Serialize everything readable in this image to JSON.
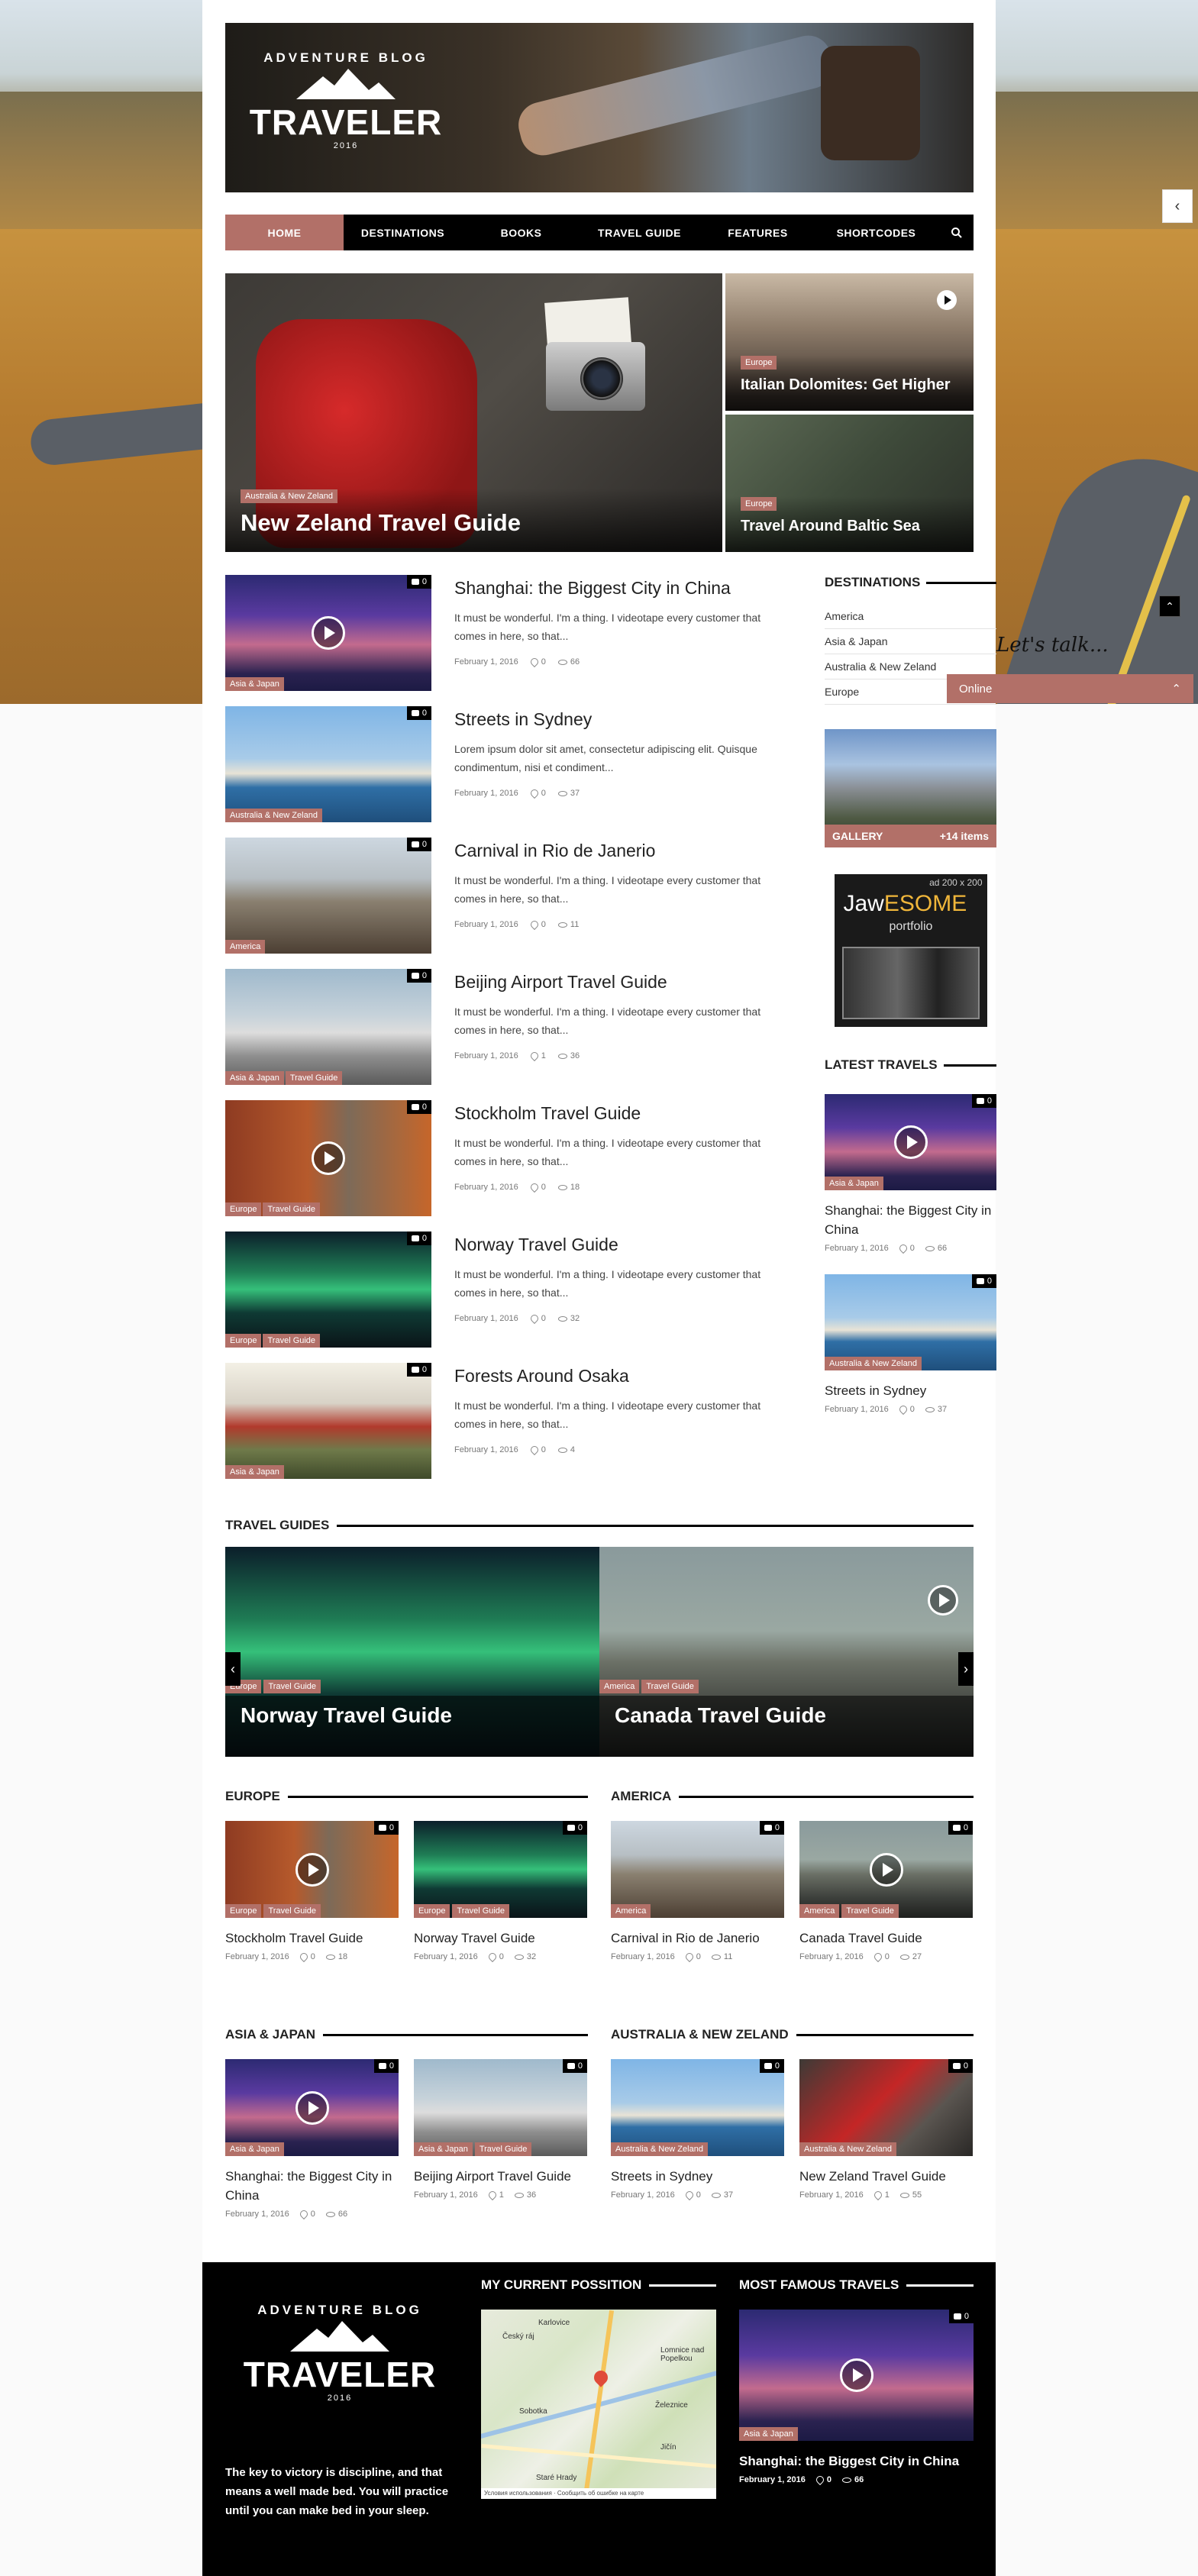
{
  "colors": {
    "accent": "#b27068",
    "nav_bg": "#000000",
    "footer_bg": "#000000"
  },
  "logo": {
    "arc": "ADVENTURE BLOG",
    "name": "TRAVELER",
    "year": "2016"
  },
  "nav": {
    "items": [
      {
        "label": "HOME",
        "active": true
      },
      {
        "label": "DESTINATIONS"
      },
      {
        "label": "BOOKS"
      },
      {
        "label": "TRAVEL GUIDE"
      },
      {
        "label": "FEATURES"
      },
      {
        "label": "SHORTCODES"
      }
    ],
    "search_icon": "search-icon"
  },
  "featured": {
    "main": {
      "tag": "Australia & New Zeland",
      "title": "New Zeland Travel Guide"
    },
    "side": [
      {
        "tag": "Europe",
        "title": "Italian Dolomites: Get Higher"
      },
      {
        "tag": "Europe",
        "title": "Travel Around Baltic Sea"
      }
    ]
  },
  "posts": [
    {
      "title": "Shanghai: the Biggest City in China",
      "excerpt": "It must be wonderful. I'm a thing. I videotape every customer that comes in here, so that...",
      "tags": [
        "Asia & Japan"
      ],
      "date": "February 1, 2016",
      "likes": "0",
      "views": "66",
      "comments": "0",
      "video": true
    },
    {
      "title": "Streets in Sydney",
      "excerpt": "Lorem ipsum dolor sit amet, consectetur adipiscing elit. Quisque condimentum, nisi et condiment...",
      "tags": [
        "Australia & New Zeland"
      ],
      "date": "February 1, 2016",
      "likes": "0",
      "views": "37",
      "comments": "0",
      "video": false
    },
    {
      "title": "Carnival in Rio de Janerio",
      "excerpt": "It must be wonderful. I'm a thing. I videotape every customer that comes in here, so that...",
      "tags": [
        "America"
      ],
      "date": "February 1, 2016",
      "likes": "0",
      "views": "11",
      "comments": "0",
      "video": false
    },
    {
      "title": "Beijing Airport Travel Guide",
      "excerpt": "It must be wonderful. I'm a thing. I videotape every customer that comes in here, so that...",
      "tags": [
        "Asia & Japan",
        "Travel Guide"
      ],
      "date": "February 1, 2016",
      "likes": "1",
      "views": "36",
      "comments": "0",
      "video": false
    },
    {
      "title": "Stockholm Travel Guide",
      "excerpt": "It must be wonderful. I'm a thing. I videotape every customer that comes in here, so that...",
      "tags": [
        "Europe",
        "Travel Guide"
      ],
      "date": "February 1, 2016",
      "likes": "0",
      "views": "18",
      "comments": "0",
      "video": true
    },
    {
      "title": "Norway Travel Guide",
      "excerpt": "It must be wonderful. I'm a thing. I videotape every customer that comes in here, so that...",
      "tags": [
        "Europe",
        "Travel Guide"
      ],
      "date": "February 1, 2016",
      "likes": "0",
      "views": "32",
      "comments": "0",
      "video": false
    },
    {
      "title": "Forests Around Osaka",
      "excerpt": "It must be wonderful. I'm a thing. I videotape every customer that comes in here, so that...",
      "tags": [
        "Asia & Japan"
      ],
      "date": "February 1, 2016",
      "likes": "0",
      "views": "4",
      "comments": "0",
      "video": false
    }
  ],
  "sidebar": {
    "destinations_title": "DESTINATIONS",
    "destinations": [
      "America",
      "Asia & Japan",
      "Australia & New Zeland",
      "Europe"
    ],
    "gallery_label": "GALLERY",
    "gallery_count": "+14 items",
    "ad": {
      "size": "ad 200 x 200",
      "title_a": "Jaw",
      "title_b": "ESOME",
      "sub": "portfolio"
    },
    "latest_title": "LATEST TRAVELS",
    "latest": [
      {
        "title": "Shanghai: the Biggest City in China",
        "tag": "Asia & Japan",
        "date": "February 1, 2016",
        "likes": "0",
        "views": "66",
        "comments": "0",
        "video": true
      },
      {
        "title": "Streets in Sydney",
        "tag": "Australia & New Zeland",
        "date": "February 1, 2016",
        "likes": "0",
        "views": "37",
        "comments": "0",
        "video": false
      }
    ]
  },
  "guides": {
    "title": "TRAVEL GUIDES",
    "slides": [
      {
        "title": "Norway Travel Guide",
        "tags": [
          "Europe",
          "Travel Guide"
        ],
        "video": false
      },
      {
        "title": "Canada Travel Guide",
        "tags": [
          "America",
          "Travel Guide"
        ],
        "video": true
      }
    ]
  },
  "categories": [
    {
      "title": "EUROPE",
      "items": [
        {
          "title": "Stockholm Travel Guide",
          "tags": [
            "Europe",
            "Travel Guide"
          ],
          "date": "February 1, 2016",
          "likes": "0",
          "views": "18",
          "comments": "0",
          "video": true
        },
        {
          "title": "Norway Travel Guide",
          "tags": [
            "Europe",
            "Travel Guide"
          ],
          "date": "February 1, 2016",
          "likes": "0",
          "views": "32",
          "comments": "0",
          "video": false
        }
      ]
    },
    {
      "title": "AMERICA",
      "items": [
        {
          "title": "Carnival in Rio de Janerio",
          "tags": [
            "America"
          ],
          "date": "February 1, 2016",
          "likes": "0",
          "views": "11",
          "comments": "0",
          "video": false
        },
        {
          "title": "Canada Travel Guide",
          "tags": [
            "America",
            "Travel Guide"
          ],
          "date": "February 1, 2016",
          "likes": "0",
          "views": "27",
          "comments": "0",
          "video": true
        }
      ]
    },
    {
      "title": "ASIA & JAPAN",
      "items": [
        {
          "title": "Shanghai: the Biggest City in China",
          "tags": [
            "Asia & Japan"
          ],
          "date": "February 1, 2016",
          "likes": "0",
          "views": "66",
          "comments": "0",
          "video": true
        },
        {
          "title": "Beijing Airport Travel Guide",
          "tags": [
            "Asia & Japan",
            "Travel Guide"
          ],
          "date": "February 1, 2016",
          "likes": "1",
          "views": "36",
          "comments": "0",
          "video": false
        }
      ]
    },
    {
      "title": "AUSTRALIA & NEW ZELAND",
      "items": [
        {
          "title": "Streets in Sydney",
          "tags": [
            "Australia & New Zeland"
          ],
          "date": "February 1, 2016",
          "likes": "0",
          "views": "37",
          "comments": "0",
          "video": false
        },
        {
          "title": "New Zeland Travel Guide",
          "tags": [
            "Australia & New Zeland"
          ],
          "date": "February 1, 2016",
          "likes": "1",
          "views": "55",
          "comments": "0",
          "video": false
        }
      ]
    }
  ],
  "footer": {
    "about": "The key to victory is discipline, and that means a well made bed. You will practice until you can make bed in your sleep.",
    "position_title": "MY CURRENT POSSITION",
    "map_labels": [
      "Karlovice",
      "Český ráj",
      "Sobotka",
      "Lomnice nad Popelkou",
      "Železnice",
      "Jičín",
      "Staré Hrady"
    ],
    "map_footer": "Условия использования · Сообщить об ошибке на карте",
    "famous_title": "MOST FAMOUS TRAVELS",
    "famous": {
      "title": "Shanghai: the Biggest City in China",
      "tag": "Asia & Japan",
      "date": "February 1, 2016",
      "likes": "0",
      "views": "66",
      "comments": "0"
    }
  },
  "chat": {
    "script": "Let's talk...",
    "status": "Online"
  }
}
